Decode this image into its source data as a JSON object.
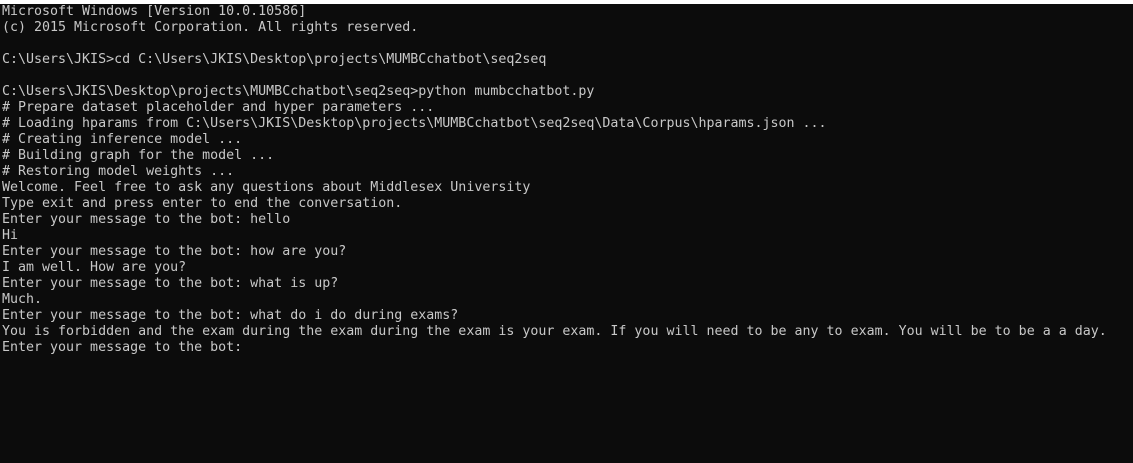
{
  "console": {
    "lines": [
      "Microsoft Windows [Version 10.0.10586]",
      "(c) 2015 Microsoft Corporation. All rights reserved.",
      "",
      "C:\\Users\\JKIS>cd C:\\Users\\JKIS\\Desktop\\projects\\MUMBCchatbot\\seq2seq",
      "",
      "C:\\Users\\JKIS\\Desktop\\projects\\MUMBCchatbot\\seq2seq>python mumbcchatbot.py",
      "# Prepare dataset placeholder and hyper parameters ...",
      "# Loading hparams from C:\\Users\\JKIS\\Desktop\\projects\\MUMBCchatbot\\seq2seq\\Data\\Corpus\\hparams.json ...",
      "# Creating inference model ...",
      "# Building graph for the model ...",
      "# Restoring model weights ...",
      "Welcome. Feel free to ask any questions about Middlesex University",
      "Type exit and press enter to end the conversation.",
      "Enter your message to the bot: hello",
      "Hi",
      "Enter your message to the bot: how are you?",
      "I am well. How are you?",
      "Enter your message to the bot: what is up?",
      "Much.",
      "Enter your message to the bot: what do i do during exams?",
      "You is forbidden and the exam during the exam during the exam is your exam. If you will need to be any to exam. You will be to be a a day.",
      "Enter your message to the bot:"
    ]
  },
  "colors": {
    "background": "#0c0c0c",
    "text": "#c8c8c8"
  }
}
